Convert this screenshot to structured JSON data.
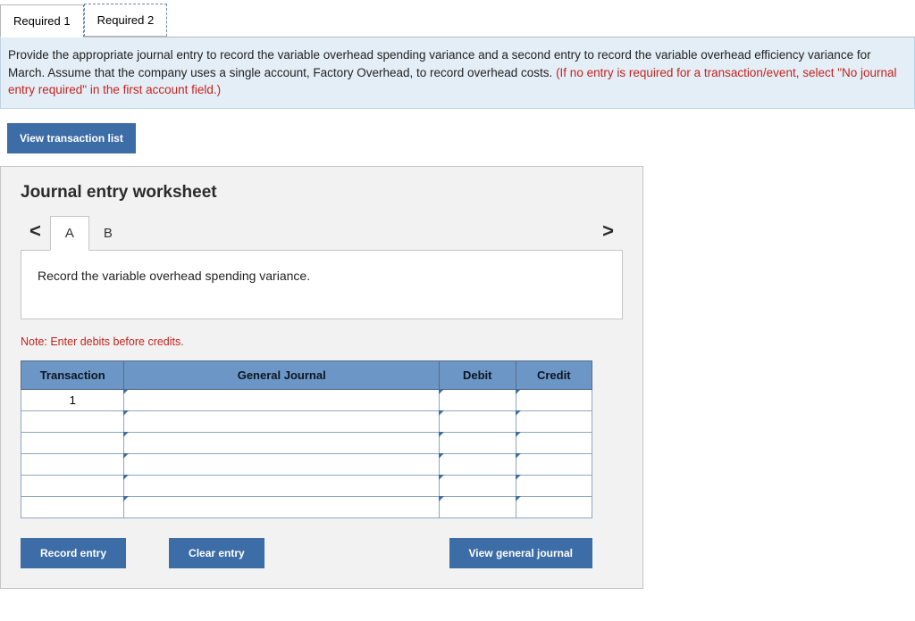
{
  "tabs": {
    "required1": "Required 1",
    "required2": "Required 2"
  },
  "instruction": {
    "main": "Provide the appropriate journal entry to record the variable overhead spending variance and a second entry to record the variable overhead efficiency variance for March. Assume that the company uses a single account, Factory Overhead, to record overhead costs. ",
    "red": "(If no entry is required for a transaction/event, select \"No journal entry required\" in the first account field.)"
  },
  "buttons": {
    "view_transaction_list": "View transaction list",
    "record_entry": "Record entry",
    "clear_entry": "Clear entry",
    "view_general_journal": "View general journal"
  },
  "worksheet": {
    "title": "Journal entry worksheet",
    "nav_prev": "<",
    "nav_next": ">",
    "letter_tabs": {
      "a": "A",
      "b": "B"
    },
    "prompt": "Record the variable overhead spending variance.",
    "note": "Note: Enter debits before credits."
  },
  "table": {
    "headers": {
      "transaction": "Transaction",
      "general_journal": "General Journal",
      "debit": "Debit",
      "credit": "Credit"
    },
    "first_row_txn": "1"
  }
}
